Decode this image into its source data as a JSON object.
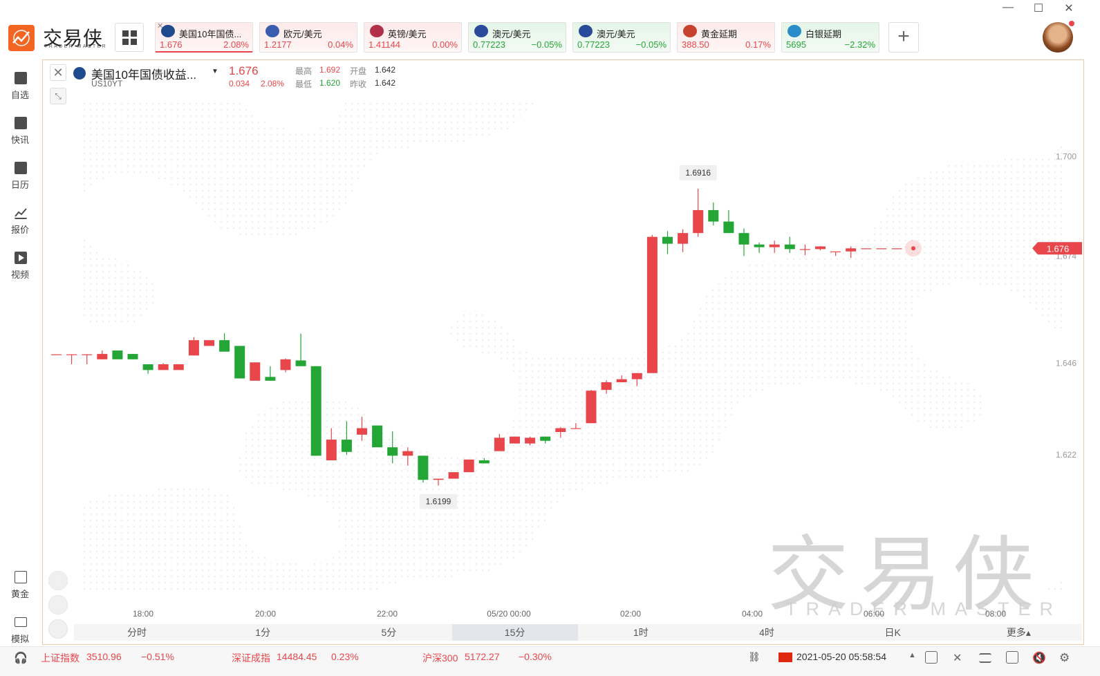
{
  "app": {
    "brand": "交易侠",
    "brand_sub": "TRADER MASTER",
    "window_controls": [
      "—",
      "☐",
      "✕"
    ]
  },
  "tickers": [
    {
      "name": "美国10年国债...",
      "price": "1.676",
      "change": "2.08%",
      "dir": "up",
      "active": true
    },
    {
      "name": "欧元/美元",
      "price": "1.2177",
      "change": "0.04%",
      "dir": "up",
      "active": false
    },
    {
      "name": "英镑/美元",
      "price": "1.41144",
      "change": "0.00%",
      "dir": "up",
      "active": false
    },
    {
      "name": "澳元/美元",
      "price": "0.77223",
      "change": "−0.05%",
      "dir": "down",
      "active": false
    },
    {
      "name": "澳元/美元",
      "price": "0.77223",
      "change": "−0.05%",
      "dir": "down",
      "active": false
    },
    {
      "name": "黄金延期",
      "price": "388.50",
      "change": "0.17%",
      "dir": "up",
      "active": false
    },
    {
      "name": "白银延期",
      "price": "5695",
      "change": "−2.32%",
      "dir": "down",
      "active": false
    }
  ],
  "sidebar": {
    "items": [
      {
        "label": "自选",
        "icon": "bookmark-icon"
      },
      {
        "label": "快讯",
        "icon": "news-icon"
      },
      {
        "label": "日历",
        "icon": "calendar-icon"
      },
      {
        "label": "报价",
        "icon": "quote-icon"
      },
      {
        "label": "视频",
        "icon": "video-icon"
      }
    ],
    "bottom": [
      {
        "label": "黄金",
        "icon": "gold-icon"
      },
      {
        "label": "模拟",
        "icon": "wallet-icon"
      }
    ]
  },
  "symbol": {
    "name": "美国10年国债收益...",
    "code": "US10YT",
    "price": "1.676",
    "change": "0.034",
    "change_pct": "2.08%",
    "high_label": "最高",
    "high": "1.692",
    "low_label": "最低",
    "low": "1.620",
    "open_label": "开盘",
    "open": "1.642",
    "prev_label": "昨收",
    "prev": "1.642"
  },
  "chart_data": {
    "type": "candlestick",
    "interval": "15分",
    "y_ticks": [
      "1.700",
      "1.674",
      "1.646",
      "1.622"
    ],
    "x_ticks": [
      "18:00",
      "20:00",
      "22:00",
      "05/20 00:00",
      "02:00",
      "04:00",
      "06:00",
      "08:00"
    ],
    "current_price_label": "1.676",
    "max_label": "1.6916",
    "min_label": "1.6199",
    "colors": {
      "up": "#e8464a",
      "down": "#23a635"
    },
    "candles": [
      [
        1.6483,
        1.6483,
        1.6483,
        1.6483
      ],
      [
        1.6483,
        1.6483,
        1.6457,
        1.6483
      ],
      [
        1.6483,
        1.6483,
        1.6457,
        1.6483
      ],
      [
        1.647,
        1.6493,
        1.647,
        1.6484
      ],
      [
        1.6493,
        1.6493,
        1.647,
        1.647
      ],
      [
        1.6484,
        1.6484,
        1.647,
        1.647
      ],
      [
        1.6457,
        1.6457,
        1.6432,
        1.6442
      ],
      [
        1.6442,
        1.646,
        1.6442,
        1.6457
      ],
      [
        1.6442,
        1.6457,
        1.6442,
        1.6457
      ],
      [
        1.648,
        1.6528,
        1.648,
        1.652
      ],
      [
        1.6505,
        1.652,
        1.6505,
        1.652
      ],
      [
        1.652,
        1.6538,
        1.649,
        1.649
      ],
      [
        1.6505,
        1.6505,
        1.642,
        1.642
      ],
      [
        1.6414,
        1.646,
        1.6414,
        1.6462
      ],
      [
        1.6424,
        1.6452,
        1.6414,
        1.6414
      ],
      [
        1.6442,
        1.6472,
        1.6436,
        1.647
      ],
      [
        1.6467,
        1.6537,
        1.6467,
        1.6452
      ],
      [
        1.6452,
        1.6452,
        1.6218,
        1.6218
      ],
      [
        1.6206,
        1.629,
        1.6206,
        1.626
      ],
      [
        1.626,
        1.6308,
        1.622,
        1.6228
      ],
      [
        1.6273,
        1.632,
        1.6257,
        1.629
      ],
      [
        1.6297,
        1.6297,
        1.624,
        1.624
      ],
      [
        1.624,
        1.6282,
        1.6198,
        1.6218
      ],
      [
        1.6218,
        1.624,
        1.6192,
        1.623
      ],
      [
        1.6218,
        1.6218,
        1.6148,
        1.6155
      ],
      [
        1.6155,
        1.6158,
        1.614,
        1.6158
      ],
      [
        1.6158,
        1.6175,
        1.6158,
        1.6175
      ],
      [
        1.6175,
        1.6198,
        1.6175,
        1.6208
      ],
      [
        1.6206,
        1.6212,
        1.6206,
        1.6198
      ],
      [
        1.623,
        1.6275,
        1.623,
        1.6265
      ],
      [
        1.625,
        1.6268,
        1.625,
        1.6268
      ],
      [
        1.625,
        1.6268,
        1.6245,
        1.6265
      ],
      [
        1.6268,
        1.6268,
        1.625,
        1.6257
      ],
      [
        1.628,
        1.6293,
        1.6265,
        1.629
      ],
      [
        1.629,
        1.6303,
        1.629,
        1.629
      ],
      [
        1.6303,
        1.639,
        1.6303,
        1.6388
      ],
      [
        1.639,
        1.6415,
        1.638,
        1.641
      ],
      [
        1.641,
        1.6428,
        1.641,
        1.6418
      ],
      [
        1.6418,
        1.6434,
        1.64,
        1.6434
      ],
      [
        1.6434,
        1.6795,
        1.6434,
        1.679
      ],
      [
        1.679,
        1.6805,
        1.6745,
        1.6772
      ],
      [
        1.6772,
        1.681,
        1.675,
        1.68
      ],
      [
        1.68,
        1.6916,
        1.679,
        1.686
      ],
      [
        1.686,
        1.688,
        1.682,
        1.683
      ],
      [
        1.683,
        1.686,
        1.68,
        1.68
      ],
      [
        1.68,
        1.6812,
        1.674,
        1.677
      ],
      [
        1.677,
        1.6775,
        1.6748,
        1.6763
      ],
      [
        1.6763,
        1.678,
        1.6748,
        1.677
      ],
      [
        1.677,
        1.679,
        1.6748,
        1.6758
      ],
      [
        1.6758,
        1.677,
        1.6742,
        1.6758
      ],
      [
        1.6758,
        1.6766,
        1.6755,
        1.6765
      ],
      [
        1.675,
        1.675,
        1.674,
        1.6752
      ],
      [
        1.6752,
        1.6765,
        1.6735,
        1.676
      ],
      [
        1.676,
        1.676,
        1.676,
        1.676
      ],
      [
        1.676,
        1.676,
        1.676,
        1.676
      ],
      [
        1.676,
        1.676,
        1.676,
        1.676
      ]
    ]
  },
  "watermark": {
    "main": "交易侠",
    "sub": "TRADER MASTER"
  },
  "periods": [
    "分时",
    "1分",
    "5分",
    "15分",
    "1时",
    "4时",
    "日K",
    "更多▴"
  ],
  "selected_period": "15分",
  "status": {
    "idx1_name": "上证指数",
    "idx1_value": "3510.96",
    "idx1_chg": "−0.51%",
    "idx2_name": "深证成指",
    "idx2_value": "14484.45",
    "idx2_chg": "0.23%",
    "idx3_name": "沪深300",
    "idx3_value": "5172.27",
    "idx3_chg": "−0.30%",
    "datetime": "2021-05-20 05:58:54"
  }
}
